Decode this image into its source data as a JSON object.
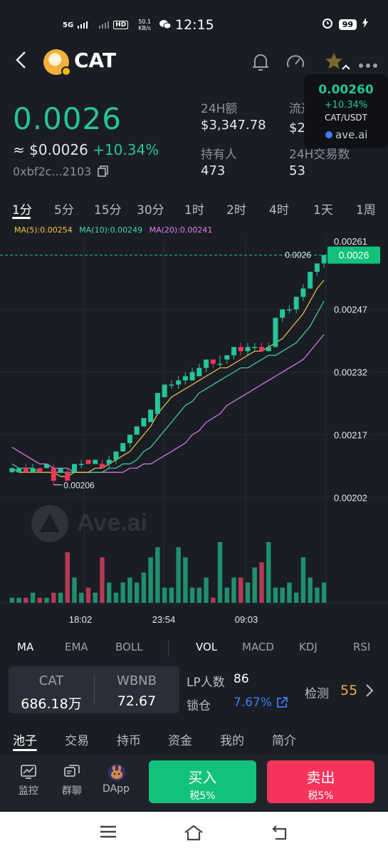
{
  "status_bar": {
    "time": "12:15",
    "network": "5G",
    "hd": "HD",
    "speed_value": "50.1",
    "speed_unit": "KB/s",
    "battery": "99"
  },
  "header": {
    "token_name": "CAT"
  },
  "price": {
    "main": "0.0026",
    "usd_prefix": "≈ ",
    "usd": "$0.0026",
    "change": "+10.34%",
    "address": "0xbf2c...2103"
  },
  "stats": {
    "volume_label": "24H额",
    "volume_value": "$3,347.78",
    "circulating_label": "流通市",
    "circulating_value": "$26.55万",
    "holders_label": "持有人",
    "holders_value": "473",
    "tx_label": "24H交易数",
    "tx_value": "53"
  },
  "popup": {
    "price": "0.00260",
    "change": "+10.34%",
    "pair": "CAT/USDT",
    "brand": "ave.ai"
  },
  "timeframes": [
    "1分",
    "5分",
    "15分",
    "30分",
    "1时",
    "2时",
    "4时",
    "1天",
    "1周"
  ],
  "ma_legend": {
    "ma5": "MA(5):0.00254",
    "ma10": "MA(10):0.00249",
    "ma20": "MA(20):0.00241"
  },
  "chart_data": {
    "type": "candlestick",
    "y_ticks": [
      "0.00247",
      "0.00232",
      "0.00217",
      "0.00202"
    ],
    "y_tick_top": "0.00261",
    "x_ticks": [
      "18:02",
      "23:54",
      "09:03"
    ],
    "current_price_tag": "0.0026",
    "current_price_label": "0.0026",
    "low_label": "0.00206",
    "watermark": "Ave.ai",
    "ylim": [
      0.00193,
      0.00263
    ],
    "candles": [
      [
        0.00208,
        0.00209,
        0.00208,
        0.00209
      ],
      [
        0.00208,
        0.00209,
        0.00208,
        0.00209
      ],
      [
        0.00209,
        0.0021,
        0.00208,
        0.00208
      ],
      [
        0.00208,
        0.0021,
        0.00208,
        0.00209
      ],
      [
        0.00209,
        0.00209,
        0.00208,
        0.00208
      ],
      [
        0.00209,
        0.0021,
        0.00209,
        0.0021
      ],
      [
        0.00209,
        0.0021,
        0.00205,
        0.00206
      ],
      [
        0.00208,
        0.00209,
        0.00208,
        0.00209
      ],
      [
        0.00208,
        0.00209,
        0.00206,
        0.00206
      ],
      [
        0.00208,
        0.0021,
        0.00208,
        0.0021
      ],
      [
        0.0021,
        0.00211,
        0.00209,
        0.0021
      ],
      [
        0.00211,
        0.00211,
        0.0021,
        0.0021
      ],
      [
        0.0021,
        0.00211,
        0.0021,
        0.00211
      ],
      [
        0.0021,
        0.00211,
        0.00209,
        0.00209
      ],
      [
        0.0021,
        0.00212,
        0.00209,
        0.00211
      ],
      [
        0.00211,
        0.00213,
        0.0021,
        0.00213
      ],
      [
        0.00213,
        0.00215,
        0.00213,
        0.00215
      ],
      [
        0.00215,
        0.00217,
        0.00214,
        0.00217
      ],
      [
        0.00217,
        0.00219,
        0.00217,
        0.00219
      ],
      [
        0.00219,
        0.00221,
        0.00219,
        0.00221
      ],
      [
        0.0022,
        0.00223,
        0.0022,
        0.00223
      ],
      [
        0.00222,
        0.00227,
        0.00222,
        0.00227
      ],
      [
        0.00226,
        0.00229,
        0.00226,
        0.00229
      ],
      [
        0.00229,
        0.0023,
        0.00228,
        0.00229
      ],
      [
        0.00229,
        0.00231,
        0.00228,
        0.0023
      ],
      [
        0.0023,
        0.00232,
        0.00229,
        0.00231
      ],
      [
        0.0023,
        0.00233,
        0.0023,
        0.00232
      ],
      [
        0.00231,
        0.00234,
        0.00231,
        0.00233
      ],
      [
        0.00233,
        0.00235,
        0.00232,
        0.00235
      ],
      [
        0.00235,
        0.00235,
        0.00233,
        0.00234
      ],
      [
        0.00234,
        0.00236,
        0.00233,
        0.00234
      ],
      [
        0.00235,
        0.00236,
        0.00234,
        0.00236
      ],
      [
        0.00236,
        0.00238,
        0.00235,
        0.00238
      ],
      [
        0.00238,
        0.00239,
        0.00236,
        0.00237
      ],
      [
        0.00237,
        0.00239,
        0.00236,
        0.00238
      ],
      [
        0.00238,
        0.00239,
        0.00237,
        0.00238
      ],
      [
        0.00238,
        0.00239,
        0.00237,
        0.00237
      ],
      [
        0.00237,
        0.00239,
        0.00237,
        0.00238
      ],
      [
        0.00238,
        0.00245,
        0.00238,
        0.00245
      ],
      [
        0.00245,
        0.00247,
        0.00244,
        0.00247
      ],
      [
        0.00247,
        0.00248,
        0.00246,
        0.00247
      ],
      [
        0.00247,
        0.0025,
        0.00246,
        0.0025
      ],
      [
        0.0025,
        0.00253,
        0.00249,
        0.00252
      ],
      [
        0.00252,
        0.00256,
        0.00252,
        0.00256
      ],
      [
        0.00256,
        0.00258,
        0.00255,
        0.00258
      ],
      [
        0.00258,
        0.0026,
        0.00257,
        0.0026
      ]
    ],
    "ma5": [
      0.00209,
      0.00208,
      0.00208,
      0.00208,
      0.00208,
      0.00208,
      0.00208,
      0.00207,
      0.00207,
      0.00208,
      0.00208,
      0.00208,
      0.00209,
      0.00209,
      0.0021,
      0.00211,
      0.00212,
      0.00213,
      0.00215,
      0.00217,
      0.00219,
      0.00222,
      0.00224,
      0.00226,
      0.00227,
      0.00228,
      0.00229,
      0.0023,
      0.00231,
      0.00232,
      0.00233,
      0.00233,
      0.00234,
      0.00235,
      0.00236,
      0.00237,
      0.00237,
      0.00238,
      0.00239,
      0.0024,
      0.00242,
      0.00244,
      0.00246,
      0.00249,
      0.00252,
      0.00254
    ],
    "ma10": [
      0.0021,
      0.00209,
      0.00209,
      0.00209,
      0.00208,
      0.00208,
      0.00208,
      0.00208,
      0.00208,
      0.00208,
      0.00208,
      0.00208,
      0.00208,
      0.00208,
      0.00209,
      0.00209,
      0.0021,
      0.0021,
      0.00211,
      0.00213,
      0.00214,
      0.00216,
      0.00218,
      0.0022,
      0.00222,
      0.00224,
      0.00225,
      0.00227,
      0.00228,
      0.00229,
      0.0023,
      0.00231,
      0.00232,
      0.00233,
      0.00233,
      0.00234,
      0.00235,
      0.00236,
      0.00236,
      0.00237,
      0.00238,
      0.00239,
      0.00241,
      0.00243,
      0.00246,
      0.00249
    ],
    "ma20": [
      0.00214,
      0.00213,
      0.00212,
      0.00211,
      0.0021,
      0.0021,
      0.00209,
      0.00209,
      0.00209,
      0.00208,
      0.00208,
      0.00208,
      0.00208,
      0.00208,
      0.00208,
      0.00208,
      0.00208,
      0.00209,
      0.00209,
      0.0021,
      0.0021,
      0.00211,
      0.00212,
      0.00213,
      0.00214,
      0.00215,
      0.00217,
      0.00218,
      0.0022,
      0.00221,
      0.00222,
      0.00224,
      0.00225,
      0.00226,
      0.00227,
      0.00228,
      0.00229,
      0.0023,
      0.00231,
      0.00232,
      0.00233,
      0.00234,
      0.00235,
      0.00237,
      0.00239,
      0.00241
    ],
    "volumes": [
      1,
      1,
      1,
      2,
      1,
      1,
      2,
      2,
      10,
      5,
      2,
      3,
      2,
      9,
      4,
      2,
      4,
      5,
      4,
      6,
      9,
      11,
      3,
      3,
      11,
      9,
      3,
      3,
      5,
      1,
      12,
      3,
      5,
      5,
      4,
      7,
      8,
      12,
      3,
      3,
      4,
      2,
      9,
      5,
      3,
      4
    ],
    "volume_max": 12
  },
  "indicators": [
    "MA",
    "EMA",
    "BOLL",
    "VOL",
    "MACD",
    "KDJ",
    "RSI"
  ],
  "pool": {
    "token_a_label": "CAT",
    "token_a_value": "686.18万",
    "token_b_label": "WBNB",
    "token_b_value": "72.67",
    "lp_label": "LP人数",
    "lp_value": "86",
    "lock_label": "锁仓",
    "lock_value": "7.67%",
    "check_label": "检测",
    "check_score": "55"
  },
  "bottom_tabs": [
    "池子",
    "交易",
    "持币",
    "资金",
    "我的",
    "简介"
  ],
  "bottom_bar": {
    "monitor": "监控",
    "group_chat": "群聊",
    "dapp": "DApp",
    "buy": "买入",
    "buy_tax": "税5%",
    "sell": "卖出",
    "sell_tax": "税5%"
  },
  "colors": {
    "up": "#27c497",
    "down": "#f4345b",
    "ma5": "#f5c542",
    "ma10": "#3fd8a8",
    "ma20": "#e07ef0",
    "background": "#1a1d24"
  }
}
